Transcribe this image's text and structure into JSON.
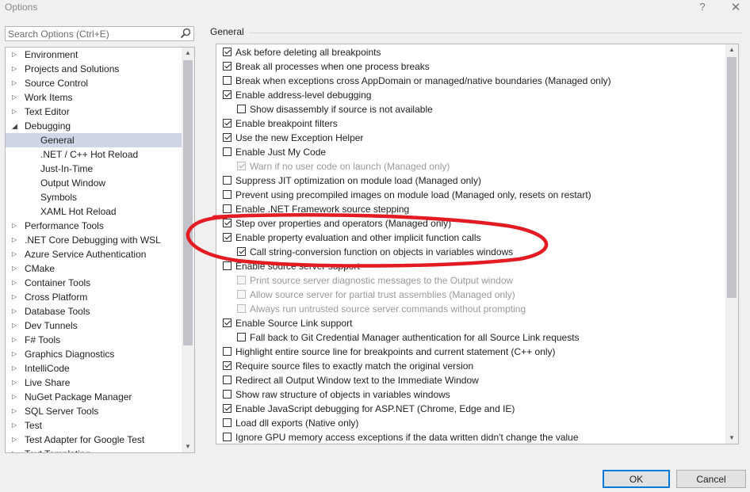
{
  "window": {
    "title": "Options",
    "help_label": "?",
    "close_label": "✕"
  },
  "search": {
    "placeholder": "Search Options (Ctrl+E)",
    "icon": "search-icon"
  },
  "tree": {
    "items": [
      {
        "label": "Environment",
        "level": 0,
        "expander": "collapsed"
      },
      {
        "label": "Projects and Solutions",
        "level": 0,
        "expander": "collapsed"
      },
      {
        "label": "Source Control",
        "level": 0,
        "expander": "collapsed"
      },
      {
        "label": "Work Items",
        "level": 0,
        "expander": "collapsed"
      },
      {
        "label": "Text Editor",
        "level": 0,
        "expander": "collapsed"
      },
      {
        "label": "Debugging",
        "level": 0,
        "expander": "expanded"
      },
      {
        "label": "General",
        "level": 1,
        "expander": "none",
        "selected": true
      },
      {
        "label": ".NET / C++ Hot Reload",
        "level": 1,
        "expander": "none"
      },
      {
        "label": "Just-In-Time",
        "level": 1,
        "expander": "none"
      },
      {
        "label": "Output Window",
        "level": 1,
        "expander": "none"
      },
      {
        "label": "Symbols",
        "level": 1,
        "expander": "none"
      },
      {
        "label": "XAML Hot Reload",
        "level": 1,
        "expander": "none"
      },
      {
        "label": "Performance Tools",
        "level": 0,
        "expander": "collapsed"
      },
      {
        "label": ".NET Core Debugging with WSL",
        "level": 0,
        "expander": "collapsed"
      },
      {
        "label": "Azure Service Authentication",
        "level": 0,
        "expander": "collapsed"
      },
      {
        "label": "CMake",
        "level": 0,
        "expander": "collapsed"
      },
      {
        "label": "Container Tools",
        "level": 0,
        "expander": "collapsed"
      },
      {
        "label": "Cross Platform",
        "level": 0,
        "expander": "collapsed"
      },
      {
        "label": "Database Tools",
        "level": 0,
        "expander": "collapsed"
      },
      {
        "label": "Dev Tunnels",
        "level": 0,
        "expander": "collapsed"
      },
      {
        "label": "F# Tools",
        "level": 0,
        "expander": "collapsed"
      },
      {
        "label": "Graphics Diagnostics",
        "level": 0,
        "expander": "collapsed"
      },
      {
        "label": "IntelliCode",
        "level": 0,
        "expander": "collapsed"
      },
      {
        "label": "Live Share",
        "level": 0,
        "expander": "collapsed"
      },
      {
        "label": "NuGet Package Manager",
        "level": 0,
        "expander": "collapsed"
      },
      {
        "label": "SQL Server Tools",
        "level": 0,
        "expander": "collapsed"
      },
      {
        "label": "Test",
        "level": 0,
        "expander": "collapsed"
      },
      {
        "label": "Test Adapter for Google Test",
        "level": 0,
        "expander": "collapsed"
      },
      {
        "label": "Text Templating",
        "level": 0,
        "expander": "collapsed"
      }
    ]
  },
  "section": {
    "title": "General"
  },
  "options": [
    {
      "label": "Ask before deleting all breakpoints",
      "checked": true,
      "indent": 0,
      "enabled": true
    },
    {
      "label": "Break all processes when one process breaks",
      "checked": true,
      "indent": 0,
      "enabled": true
    },
    {
      "label": "Break when exceptions cross AppDomain or managed/native boundaries (Managed only)",
      "checked": false,
      "indent": 0,
      "enabled": true
    },
    {
      "label": "Enable address-level debugging",
      "checked": true,
      "indent": 0,
      "enabled": true
    },
    {
      "label": "Show disassembly if source is not available",
      "checked": false,
      "indent": 1,
      "enabled": true
    },
    {
      "label": "Enable breakpoint filters",
      "checked": true,
      "indent": 0,
      "enabled": true
    },
    {
      "label": "Use the new Exception Helper",
      "checked": true,
      "indent": 0,
      "enabled": true
    },
    {
      "label": "Enable Just My Code",
      "checked": false,
      "indent": 0,
      "enabled": true
    },
    {
      "label": "Warn if no user code on launch (Managed only)",
      "checked": true,
      "indent": 1,
      "enabled": false
    },
    {
      "label": "Suppress JIT optimization on module load (Managed only)",
      "checked": false,
      "indent": 0,
      "enabled": true
    },
    {
      "label": "Prevent using precompiled images on module load (Managed only, resets on restart)",
      "checked": false,
      "indent": 0,
      "enabled": true
    },
    {
      "label": "Enable .NET Framework source stepping",
      "checked": false,
      "indent": 0,
      "enabled": true
    },
    {
      "label": "Step over properties and operators (Managed only)",
      "checked": true,
      "indent": 0,
      "enabled": true
    },
    {
      "label": "Enable property evaluation and other implicit function calls",
      "checked": true,
      "indent": 0,
      "enabled": true
    },
    {
      "label": "Call string-conversion function on objects in variables windows",
      "checked": true,
      "indent": 1,
      "enabled": true
    },
    {
      "label": "Enable source server support",
      "checked": false,
      "indent": 0,
      "enabled": true
    },
    {
      "label": "Print source server diagnostic messages to the Output window",
      "checked": false,
      "indent": 1,
      "enabled": false
    },
    {
      "label": "Allow source server for partial trust assemblies (Managed only)",
      "checked": false,
      "indent": 1,
      "enabled": false
    },
    {
      "label": "Always run untrusted source server commands without prompting",
      "checked": false,
      "indent": 1,
      "enabled": false
    },
    {
      "label": "Enable Source Link support",
      "checked": true,
      "indent": 0,
      "enabled": true
    },
    {
      "label": "Fall back to Git Credential Manager authentication for all Source Link requests",
      "checked": false,
      "indent": 1,
      "enabled": true
    },
    {
      "label": "Highlight entire source line for breakpoints and current statement (C++ only)",
      "checked": false,
      "indent": 0,
      "enabled": true
    },
    {
      "label": "Require source files to exactly match the original version",
      "checked": true,
      "indent": 0,
      "enabled": true
    },
    {
      "label": "Redirect all Output Window text to the Immediate Window",
      "checked": false,
      "indent": 0,
      "enabled": true
    },
    {
      "label": "Show raw structure of objects in variables windows",
      "checked": false,
      "indent": 0,
      "enabled": true
    },
    {
      "label": "Enable JavaScript debugging for ASP.NET (Chrome, Edge and IE)",
      "checked": true,
      "indent": 0,
      "enabled": true
    },
    {
      "label": "Load dll exports (Native only)",
      "checked": false,
      "indent": 0,
      "enabled": true
    },
    {
      "label": "Ignore GPU memory access exceptions if the data written didn't change the value",
      "checked": false,
      "indent": 0,
      "enabled": true
    }
  ],
  "buttons": {
    "ok_label": "OK",
    "cancel_label": "Cancel"
  },
  "colors": {
    "annotation": "#e31b23",
    "selection": "#cfd6e5",
    "ok_border": "#0078d7"
  }
}
